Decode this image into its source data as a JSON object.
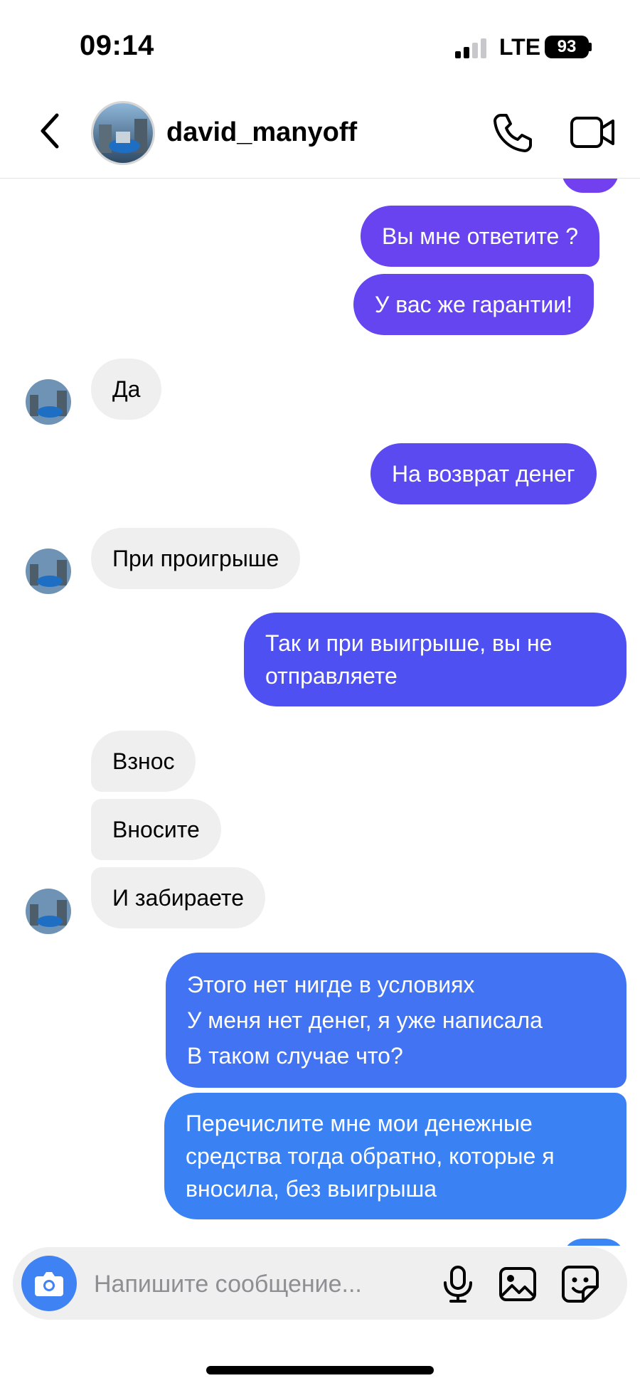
{
  "status_bar": {
    "time": "09:14",
    "network": "LTE",
    "battery": "93"
  },
  "header": {
    "username": "david_manyoff"
  },
  "colors": {
    "bubble_top": "#6a43f0",
    "bubble_mid": "#5a4af0",
    "bubble_bottom": "#3a86f4",
    "incoming": "#efefef"
  },
  "messages": [
    {
      "dir": "out",
      "text": "Вы мне ответите ?"
    },
    {
      "dir": "out",
      "text": "У вас же гарантии!"
    },
    {
      "dir": "in",
      "text": "Да"
    },
    {
      "dir": "out",
      "text": "На возврат денег"
    },
    {
      "dir": "in",
      "text": "При проигрыше"
    },
    {
      "dir": "out",
      "text": "Так и при выигрыше, вы не отправляете"
    },
    {
      "dir": "in",
      "text": "Взнос"
    },
    {
      "dir": "in",
      "text": "Вносите"
    },
    {
      "dir": "in",
      "text": "И забираете"
    },
    {
      "dir": "out",
      "text": "Этого нет нигде в условиях\nУ меня нет денег, я уже написала\nВ таком случае что?"
    },
    {
      "dir": "out",
      "text": "Перечислите мне мои денежные средства тогда обратно, которые я вносила, без выигрыша"
    }
  ],
  "composer": {
    "placeholder": "Напишите сообщение..."
  },
  "icons": [
    "back-icon",
    "call-icon",
    "video-call-icon",
    "camera-icon",
    "microphone-icon",
    "image-icon",
    "sticker-icon"
  ]
}
